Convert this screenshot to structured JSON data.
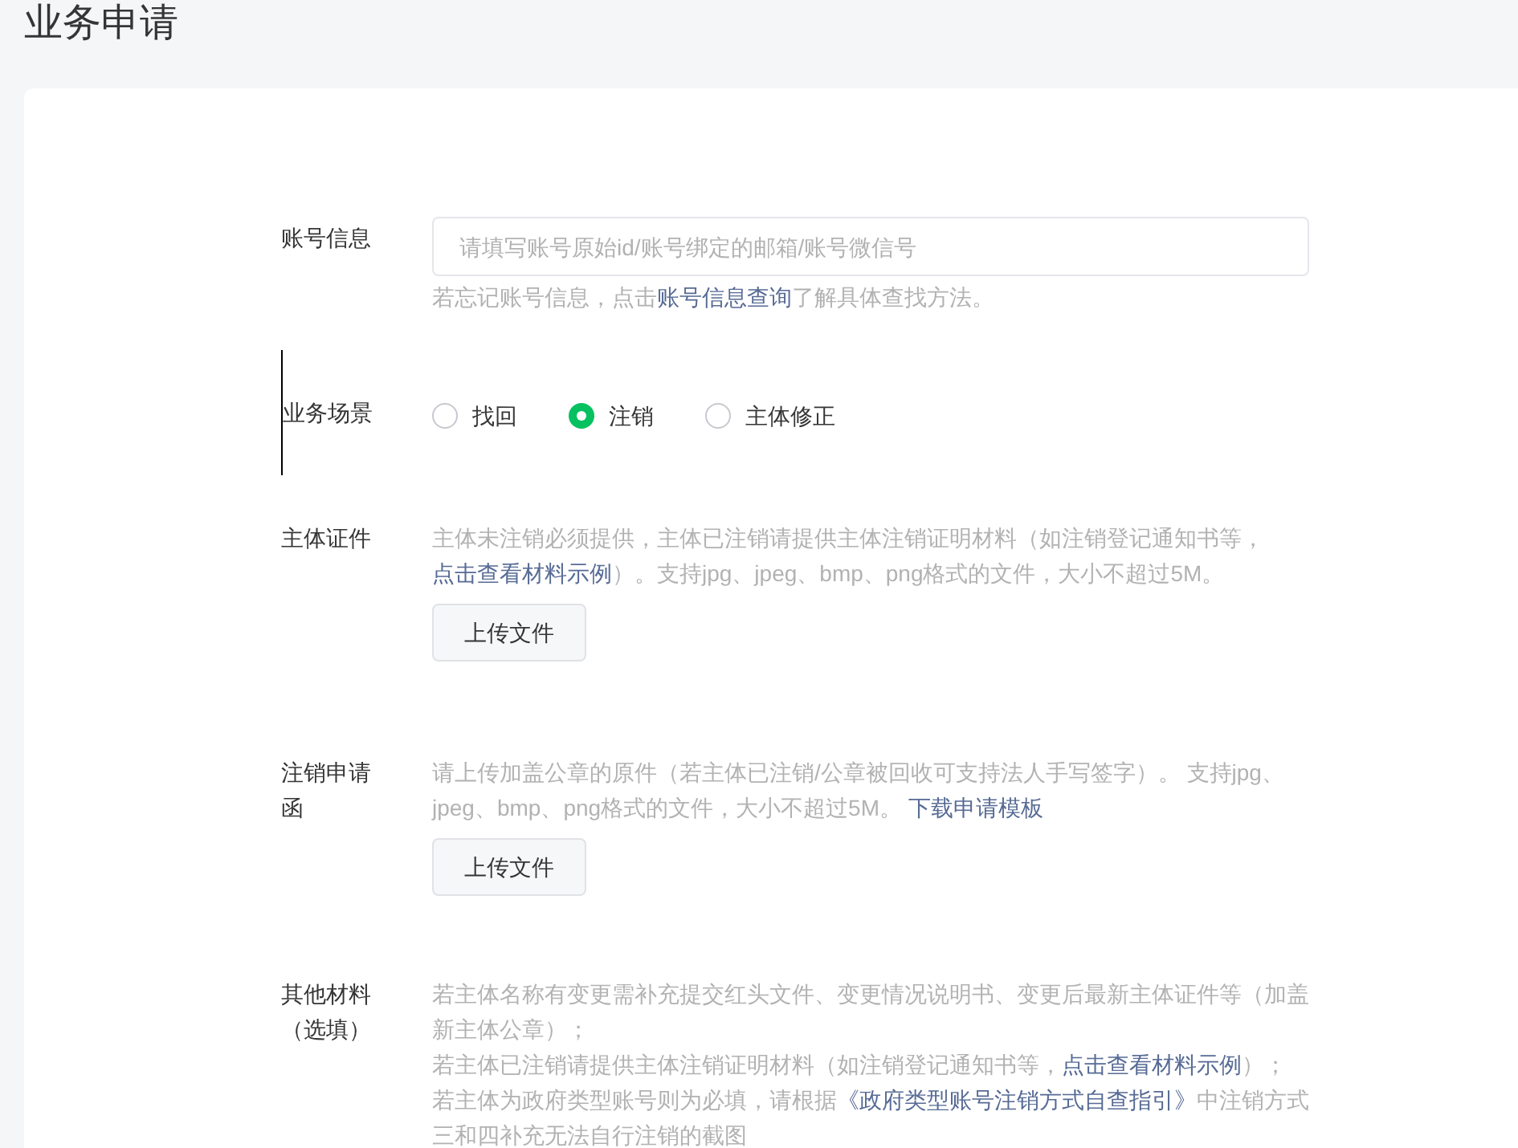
{
  "title": "业务申请",
  "form": [
    {
      "kind": "input",
      "label": [
        "账号信息"
      ],
      "placeholder": "请填写账号原始id/账号绑定的邮箱/账号微信号",
      "hint": [
        [
          {
            "text": "若忘记账号信息，点击",
            "link": false
          },
          {
            "text": "账号信息查询",
            "link": true
          },
          {
            "text": "了解具体查找方法。",
            "link": false
          }
        ]
      ]
    },
    {
      "kind": "radio",
      "label": [
        "业务场景"
      ],
      "options": [
        {
          "label": "找回",
          "selected": false
        },
        {
          "label": "注销",
          "selected": true
        },
        {
          "label": "主体修正",
          "selected": false
        }
      ]
    },
    {
      "kind": "upload",
      "label": [
        "主体证件"
      ],
      "hint": [
        [
          {
            "text": "主体未注销必须提供，主体已注销请提供主体注销证明材料（如注销登记通知书等，",
            "link": false
          },
          {
            "text": "点击查看材料示例",
            "link": true
          },
          {
            "text": "）。支持jpg、jpeg、bmp、png格式的文件，大小不超过5M。",
            "link": false
          }
        ]
      ],
      "button": "上传文件"
    },
    {
      "kind": "upload",
      "label": [
        "注销申请函"
      ],
      "hint": [
        [
          {
            "text": "请上传加盖公章的原件（若主体已注销/公章被回收可支持法人手写签字）。 支持jpg、jpeg、bmp、png格式的文件，大小不超过5M。 ",
            "link": false
          },
          {
            "text": "下载申请模板",
            "link": true
          }
        ]
      ],
      "button": "上传文件"
    },
    {
      "kind": "text",
      "label": [
        "其他材料",
        "（选填）"
      ],
      "hint": [
        [
          {
            "text": "若主体名称有变更需补充提交红头文件、变更情况说明书、变更后最新主体证件等（加盖新主体公章）；",
            "link": false
          }
        ],
        [
          {
            "text": "若主体已注销请提供主体注销证明材料（如注销登记通知书等，",
            "link": false
          },
          {
            "text": "点击查看材料示例",
            "link": true
          },
          {
            "text": "）；",
            "link": false
          }
        ],
        [
          {
            "text": "若主体为政府类型账号则为必填，请根据",
            "link": false
          },
          {
            "text": "《政府类型账号注销方式自查指引》",
            "link": true
          },
          {
            "text": "中注销方式三和四补充无法自行注销的截图",
            "link": false
          }
        ]
      ]
    }
  ]
}
